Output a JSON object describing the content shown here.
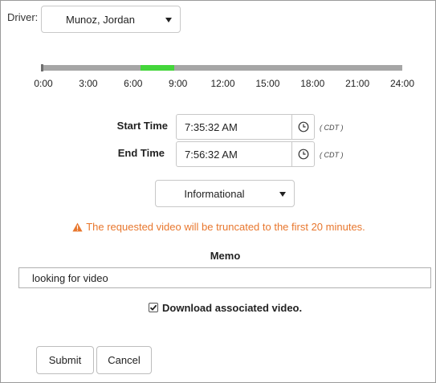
{
  "driver": {
    "label": "Driver:",
    "selected": "Munoz, Jordan"
  },
  "timeline": {
    "ticks": [
      "0:00",
      "3:00",
      "6:00",
      "9:00",
      "12:00",
      "15:00",
      "18:00",
      "21:00",
      "24:00"
    ],
    "range_start_hours": 6.5,
    "range_end_hours": 8.75,
    "range_color": "#44d63b",
    "track_color": "#a6a6a6"
  },
  "start_time": {
    "label": "Start Time",
    "value": "7:35:32 AM",
    "tz": "( CDT )"
  },
  "end_time": {
    "label": "End Time",
    "value": "7:56:32 AM",
    "tz": "( CDT )"
  },
  "category": {
    "selected": "Informational"
  },
  "warning": {
    "text": "The requested video will be truncated to the first 20 minutes.",
    "color": "#e8772e"
  },
  "memo": {
    "label": "Memo",
    "value": "looking for video"
  },
  "download": {
    "label": "Download associated video.",
    "checked": true
  },
  "buttons": {
    "submit": "Submit",
    "cancel": "Cancel"
  }
}
